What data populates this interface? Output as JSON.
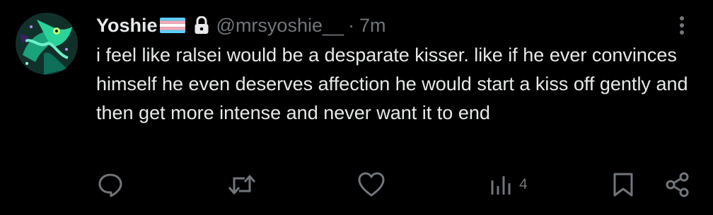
{
  "tweet": {
    "display_name": "Yoshie",
    "flag_emoji": "transgender-flag",
    "protected_icon": "lock-icon",
    "handle": "@mrsyoshie__",
    "separator": "·",
    "time": "7m",
    "text": "i feel like ralsei would be a desparate kisser. like if he ever convinces himself he even deserves affection he would start a kiss off gently and then get more intense and never want it to end",
    "more_icon": "more-vertical-icon"
  },
  "actions": {
    "reply_icon": "reply-icon",
    "retweet_icon": "retweet-icon",
    "like_icon": "heart-icon",
    "views_icon": "views-icon",
    "views_count": "4",
    "bookmark_icon": "bookmark-icon",
    "share_icon": "share-icon"
  },
  "colors": {
    "background": "#000000",
    "primary_text": "#e7e9ea",
    "secondary_text": "#71767b",
    "flag_blue": "#5bcefa",
    "flag_pink": "#f5a9b8",
    "flag_white": "#ffffff"
  }
}
